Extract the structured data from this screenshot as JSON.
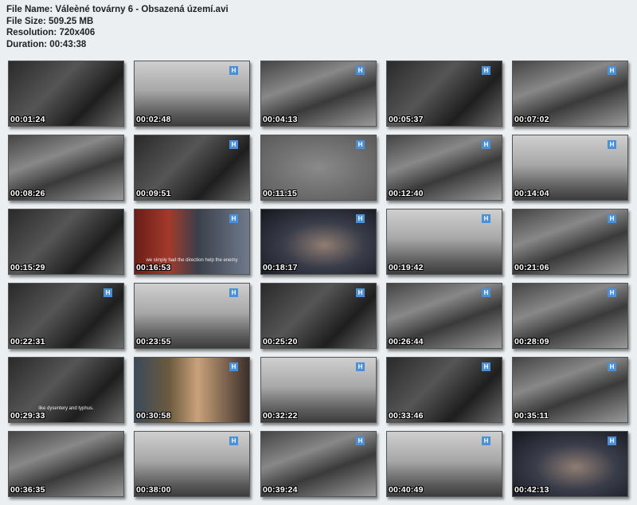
{
  "file_info": {
    "file_name": "File Name: Váleèné továrny 6 - Obsazená území.avi",
    "file_size": "File Size: 509.25 MB",
    "resolution": "Resolution: 720x406",
    "duration": "Duration: 00:43:38"
  },
  "thumbnails": [
    {
      "time": "00:01:24",
      "tone": "bw-dark",
      "logo": false,
      "subtitle": ""
    },
    {
      "time": "00:02:48",
      "tone": "bw-light",
      "logo": true,
      "subtitle": ""
    },
    {
      "time": "00:04:13",
      "tone": "bw-mid",
      "logo": true,
      "subtitle": ""
    },
    {
      "time": "00:05:37",
      "tone": "bw-dark",
      "logo": true,
      "subtitle": ""
    },
    {
      "time": "00:07:02",
      "tone": "bw-mid",
      "logo": true,
      "subtitle": ""
    },
    {
      "time": "00:08:26",
      "tone": "bw-mid",
      "logo": false,
      "subtitle": ""
    },
    {
      "time": "00:09:51",
      "tone": "bw-dark",
      "logo": true,
      "subtitle": ""
    },
    {
      "time": "00:11:15",
      "tone": "bw-flat",
      "logo": true,
      "subtitle": ""
    },
    {
      "time": "00:12:40",
      "tone": "bw-mid",
      "logo": true,
      "subtitle": ""
    },
    {
      "time": "00:14:04",
      "tone": "bw-light",
      "logo": true,
      "subtitle": ""
    },
    {
      "time": "00:15:29",
      "tone": "bw-dark",
      "logo": false,
      "subtitle": ""
    },
    {
      "time": "00:16:53",
      "tone": "color-red",
      "logo": true,
      "subtitle": "we simply had the direction help the enemy"
    },
    {
      "time": "00:18:17",
      "tone": "color-dark",
      "logo": true,
      "subtitle": ""
    },
    {
      "time": "00:19:42",
      "tone": "bw-light",
      "logo": true,
      "subtitle": ""
    },
    {
      "time": "00:21:06",
      "tone": "bw-mid",
      "logo": true,
      "subtitle": ""
    },
    {
      "time": "00:22:31",
      "tone": "bw-dark",
      "logo": true,
      "subtitle": ""
    },
    {
      "time": "00:23:55",
      "tone": "bw-light",
      "logo": true,
      "subtitle": ""
    },
    {
      "time": "00:25:20",
      "tone": "bw-dark",
      "logo": true,
      "subtitle": ""
    },
    {
      "time": "00:26:44",
      "tone": "bw-mid",
      "logo": true,
      "subtitle": ""
    },
    {
      "time": "00:28:09",
      "tone": "bw-mid",
      "logo": true,
      "subtitle": ""
    },
    {
      "time": "00:29:33",
      "tone": "bw-dark",
      "logo": false,
      "subtitle": "like dysentery and typhus."
    },
    {
      "time": "00:30:58",
      "tone": "color-warm",
      "logo": true,
      "subtitle": ""
    },
    {
      "time": "00:32:22",
      "tone": "bw-light",
      "logo": true,
      "subtitle": ""
    },
    {
      "time": "00:33:46",
      "tone": "bw-dark",
      "logo": true,
      "subtitle": ""
    },
    {
      "time": "00:35:11",
      "tone": "bw-mid",
      "logo": true,
      "subtitle": ""
    },
    {
      "time": "00:36:35",
      "tone": "bw-mid",
      "logo": false,
      "subtitle": ""
    },
    {
      "time": "00:38:00",
      "tone": "bw-light",
      "logo": true,
      "subtitle": ""
    },
    {
      "time": "00:39:24",
      "tone": "bw-mid",
      "logo": true,
      "subtitle": ""
    },
    {
      "time": "00:40:49",
      "tone": "bw-light",
      "logo": true,
      "subtitle": ""
    },
    {
      "time": "00:42:13",
      "tone": "color-dark",
      "logo": true,
      "subtitle": ""
    }
  ],
  "logo_text": "H",
  "colors": {
    "background": "#ebeff2",
    "logo": "#4a90d9"
  }
}
